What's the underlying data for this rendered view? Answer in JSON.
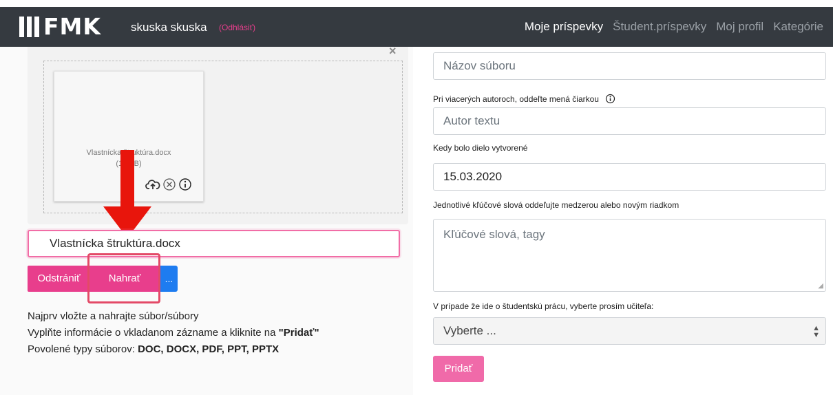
{
  "navbar": {
    "logo_text": "FMK",
    "user_name": "skuska skuska",
    "logout_label": "(Odhlásiť)",
    "links": [
      "Moje príspevky",
      "Študent.príspevky",
      "Moj profil",
      "Kategórie"
    ]
  },
  "upload": {
    "close_label": "×",
    "file_name": "Vlastnícka štruktúra.docx",
    "file_size": "(1...KB)",
    "filename_input_value": "Vlastnícka štruktúra.docx",
    "remove_label": "Odstrániť",
    "upload_label": "Nahrať",
    "more_label": "..."
  },
  "info": {
    "line1": "Najprv vložte a nahrajte súbor/súbory",
    "line2_prefix": "Vyplňte informácie o vkladanom zázname a kliknite na ",
    "line2_bold": "\"Pridať\"",
    "line3_prefix": "Povolené typy súborov: ",
    "line3_bold": "DOC, DOCX, PDF, PPT, PPTX"
  },
  "form": {
    "file_title_placeholder": "Názov súboru",
    "authors_hint": "Pri viacerých autoroch, oddeľte mená čiarkou",
    "author_placeholder": "Autor textu",
    "created_label": "Kedy bolo dielo vytvorené",
    "created_value": "15.03.2020",
    "keywords_hint": "Jednotlivé kľúčové slová oddeľujte medzerou alebo novým riadkom",
    "keywords_placeholder": "Kľúčové slová, tagy",
    "teacher_hint": "V prípade že ide o študentskú prácu, vyberte prosím učiteľa:",
    "teacher_selected": "Vyberte ...",
    "add_label": "Pridať"
  },
  "colors": {
    "navbar": "#353a40",
    "pink": "#e83e8c",
    "blue": "#1e7cf0",
    "highlight": "#e34a67"
  }
}
